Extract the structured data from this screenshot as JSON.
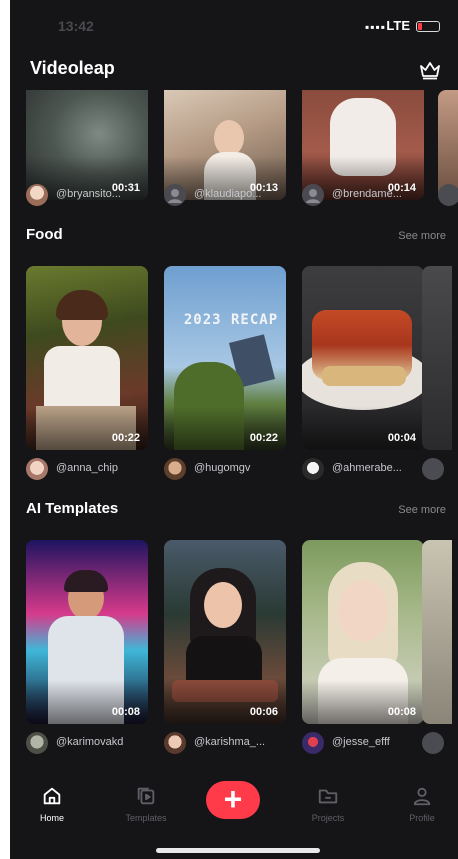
{
  "status_bar": {
    "time": "13:42",
    "network": "LTE"
  },
  "app": {
    "title": "Videoleap",
    "premium_icon": "crown-icon"
  },
  "top_row": {
    "cards": [
      {
        "duration": "00:31",
        "author": "@bryansito..."
      },
      {
        "duration": "00:13",
        "author": "@klaudiapo..."
      },
      {
        "duration": "00:14",
        "author": "@brendame..."
      }
    ]
  },
  "sections": [
    {
      "title": "Food",
      "see_more": "See more",
      "cards": [
        {
          "duration": "00:22",
          "author": "@anna_chip"
        },
        {
          "duration": "00:22",
          "author": "@hugomgv"
        },
        {
          "duration": "00:04",
          "author": "@ahmerabe..."
        }
      ]
    },
    {
      "title": "AI Templates",
      "see_more": "See more",
      "cards": [
        {
          "duration": "00:08",
          "author": "@karimovakd"
        },
        {
          "duration": "00:06",
          "author": "@karishma_..."
        },
        {
          "duration": "00:08",
          "author": "@jesse_efff"
        }
      ]
    }
  ],
  "thumbnail_overlay_text": "2023 RECAP",
  "tab_bar": {
    "items": [
      {
        "label": "Home",
        "icon": "home-icon",
        "active": true
      },
      {
        "label": "Templates",
        "icon": "templates-icon",
        "active": false
      },
      {
        "label": "Projects",
        "icon": "folder-icon",
        "active": false
      },
      {
        "label": "Profile",
        "icon": "person-icon",
        "active": false
      }
    ],
    "create_icon": "plus-icon"
  },
  "colors": {
    "background": "#151518",
    "accent": "#ff3b4a",
    "muted": "#8a8a8e"
  }
}
